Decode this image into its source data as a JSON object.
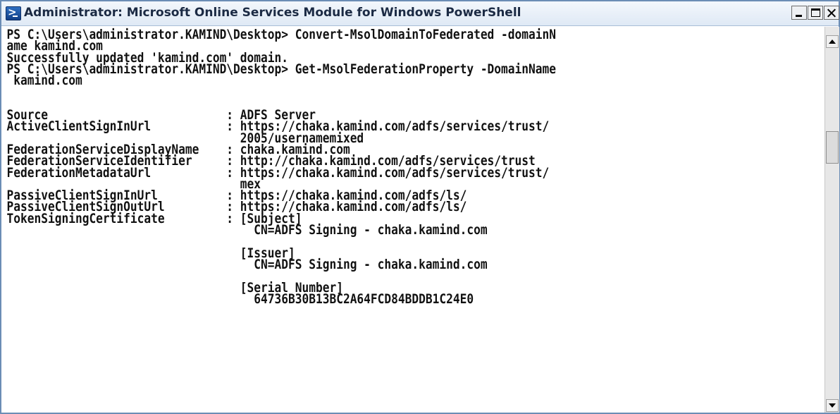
{
  "window": {
    "title": "Administrator: Microsoft Online Services Module for Windows PowerShell",
    "title_icon": "powershell-icon",
    "buttons": {
      "minimize": "minimize-icon",
      "maximize": "maximize-icon",
      "close": "close-icon"
    }
  },
  "console": {
    "text": "PS C:\\Users\\administrator.KAMIND\\Desktop> Convert-MsolDomainToFederated -domainN\name kamind.com\nSuccessfully updated 'kamind.com' domain.\nPS C:\\Users\\administrator.KAMIND\\Desktop> Get-MsolFederationProperty -DomainName\n kamind.com\n\n\nSource                          : ADFS Server\nActiveClientSignInUrl           : https://chaka.kamind.com/adfs/services/trust/\n                                  2005/usernamemixed\nFederationServiceDisplayName    : chaka.kamind.com\nFederationServiceIdentifier     : http://chaka.kamind.com/adfs/services/trust\nFederationMetadataUrl           : https://chaka.kamind.com/adfs/services/trust/\n                                  mex\nPassiveClientSignInUrl          : https://chaka.kamind.com/adfs/ls/\nPassiveClientSignOutUrl         : https://chaka.kamind.com/adfs/ls/\nTokenSigningCertificate         : [Subject]\n                                    CN=ADFS Signing - chaka.kamind.com\n\n                                  [Issuer]\n                                    CN=ADFS Signing - chaka.kamind.com\n\n                                  [Serial Number]\n                                    64736B30B13BC2A64FCD84BDDB1C24E0"
  },
  "colors": {
    "console_background": "#ffffff",
    "console_text": "#111111",
    "titlebar": "#dfe9f5",
    "window_border": "#6b8db5"
  }
}
